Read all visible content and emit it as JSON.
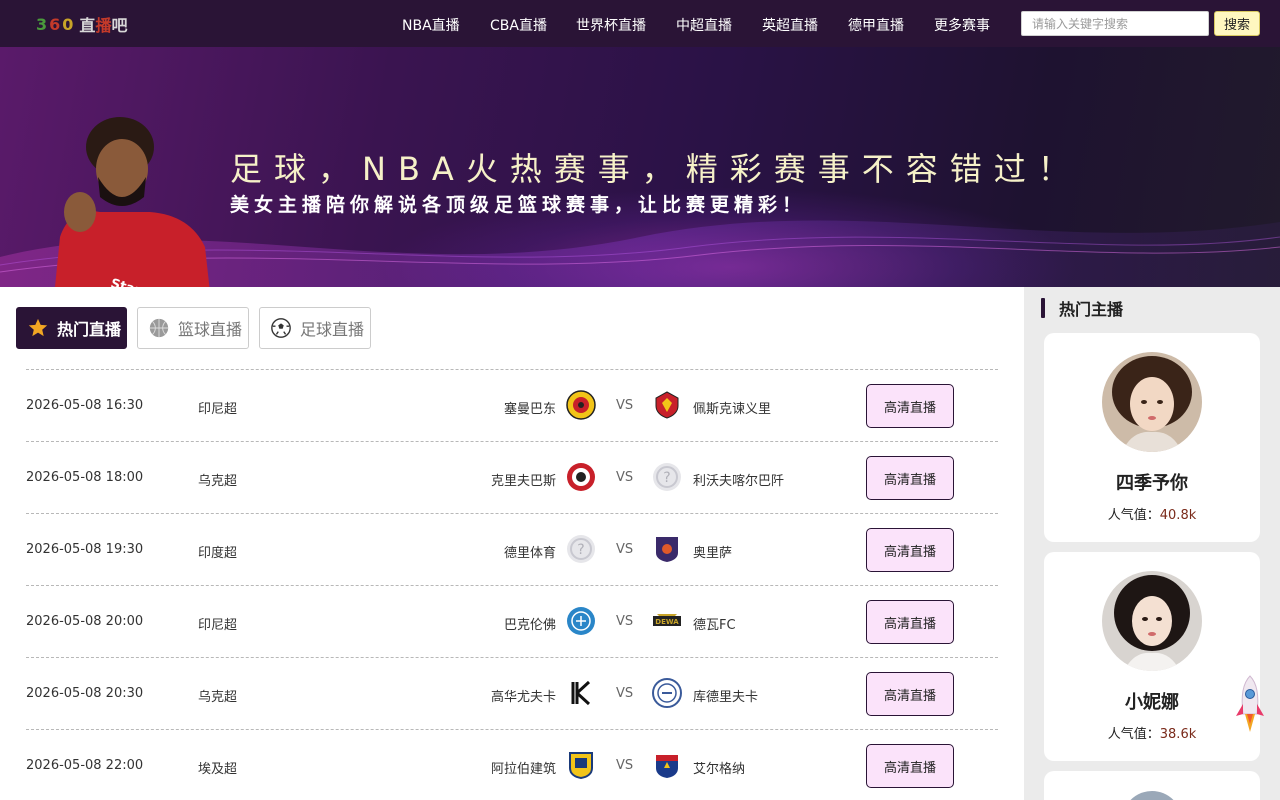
{
  "header": {
    "logo_digits": [
      "3",
      "6",
      "0"
    ],
    "logo_text_1": "直",
    "logo_text_2": "播",
    "logo_text_3": "吧",
    "nav": [
      {
        "label": "NBA直播"
      },
      {
        "label": "CBA直播"
      },
      {
        "label": "世界杯直播"
      },
      {
        "label": "中超直播"
      },
      {
        "label": "英超直播"
      },
      {
        "label": "德甲直播"
      },
      {
        "label": "更多赛事"
      }
    ],
    "search": {
      "placeholder": "请输入关键字搜索",
      "value": "",
      "button_label": "搜索"
    }
  },
  "banner": {
    "title": "足球，NBA火热赛事，精彩赛事不容错过！",
    "subtitle": "美女主播陪你解说各顶级足篮球赛事，让比赛更精彩！"
  },
  "tabs": [
    {
      "label": "热门直播",
      "icon": "star-icon",
      "active": true
    },
    {
      "label": "篮球直播",
      "icon": "basketball-icon",
      "active": false
    },
    {
      "label": "足球直播",
      "icon": "soccer-ball-icon",
      "active": false
    }
  ],
  "matches": [
    {
      "time": "2026-05-08 16:30",
      "league": "印尼超",
      "home": "塞曼巴东",
      "vs": "VS",
      "away": "佩斯克谏义里",
      "action": "高清直播"
    },
    {
      "time": "2026-05-08 18:00",
      "league": "乌克超",
      "home": "克里夫巴斯",
      "vs": "VS",
      "away": "利沃夫喀尔巴阡",
      "action": "高清直播"
    },
    {
      "time": "2026-05-08 19:30",
      "league": "印度超",
      "home": "德里体育",
      "vs": "VS",
      "away": "奥里萨",
      "action": "高清直播"
    },
    {
      "time": "2026-05-08 20:00",
      "league": "印尼超",
      "home": "巴克伦佛",
      "vs": "VS",
      "away": "德瓦FC",
      "action": "高清直播"
    },
    {
      "time": "2026-05-08 20:30",
      "league": "乌克超",
      "home": "高华尤夫卡",
      "vs": "VS",
      "away": "库德里夫卡",
      "action": "高清直播"
    },
    {
      "time": "2026-05-08 22:00",
      "league": "埃及超",
      "home": "阿拉伯建筑",
      "vs": "VS",
      "away": "艾尔格纳",
      "action": "高清直播"
    }
  ],
  "sidebar": {
    "title": "热门主播",
    "streamers": [
      {
        "name": "四季予你",
        "popularity_label": "人气值：",
        "popularity_value": "40.8k"
      },
      {
        "name": "小妮娜",
        "popularity_label": "人气值：",
        "popularity_value": "38.6k"
      }
    ]
  },
  "colors": {
    "header_bg": "#2a1436",
    "active_tab_bg": "#2a1436",
    "live_button_bg": "#fbe3fa",
    "search_button_bg": "#fff7c0",
    "banner_title": "#f6f1c8"
  }
}
